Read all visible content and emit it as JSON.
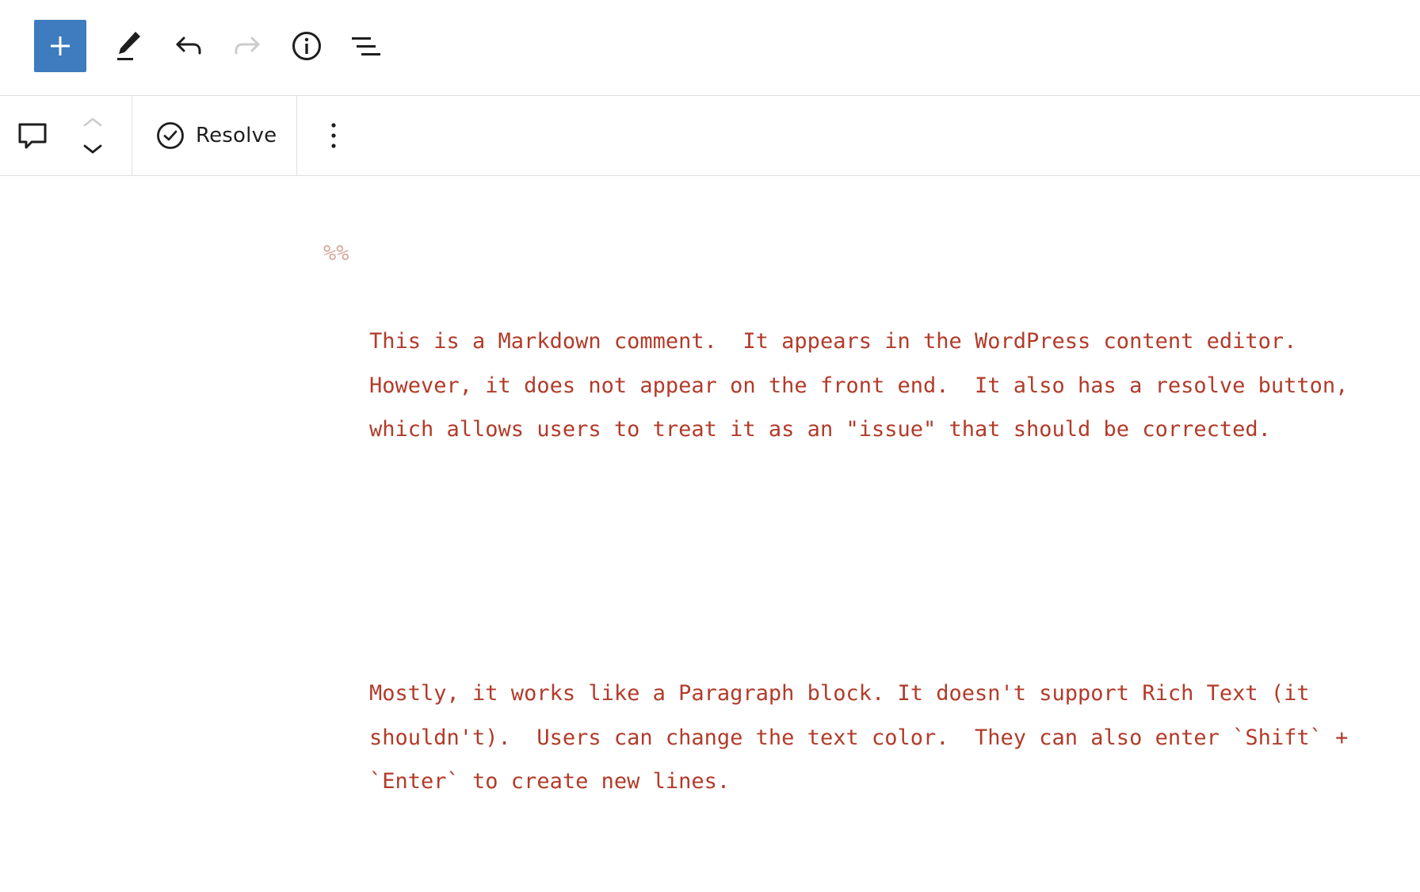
{
  "top_toolbar": {
    "inserter_icon": "plus-icon",
    "tools": [
      {
        "name": "edit",
        "icon": "pencil-icon",
        "state": "active"
      },
      {
        "name": "undo",
        "icon": "undo-icon",
        "state": "enabled"
      },
      {
        "name": "redo",
        "icon": "redo-icon",
        "state": "disabled"
      },
      {
        "name": "details",
        "icon": "info-icon",
        "state": "enabled"
      },
      {
        "name": "list-view",
        "icon": "list-view-icon",
        "state": "enabled"
      }
    ],
    "colors": {
      "accent": "#3e7bbf",
      "icon": "#1e1e1e",
      "disabled": "#cccccc"
    }
  },
  "block_toolbar": {
    "block_type_icon": "comment-icon",
    "mover_up_icon": "chevron-up-icon",
    "mover_down_icon": "chevron-down-icon",
    "resolve_label": "Resolve",
    "resolve_icon": "check-circle-icon",
    "more_icon": "more-vertical-icon"
  },
  "comment": {
    "prefix": "%%",
    "paragraphs": [
      "This is a Markdown comment.  It appears in the WordPress content editor.  However, it does not appear on the front end.  It also has a resolve button, which allows users to treat it as an \"issue\" that should be corrected.",
      "Mostly, it works like a Paragraph block. It doesn't support Rich Text (it shouldn't).  Users can change the text color.  They can also enter `Shift` + `Enter` to create new lines."
    ],
    "text_color": "#b23b2a",
    "prefix_color": "#d8a8a0"
  }
}
